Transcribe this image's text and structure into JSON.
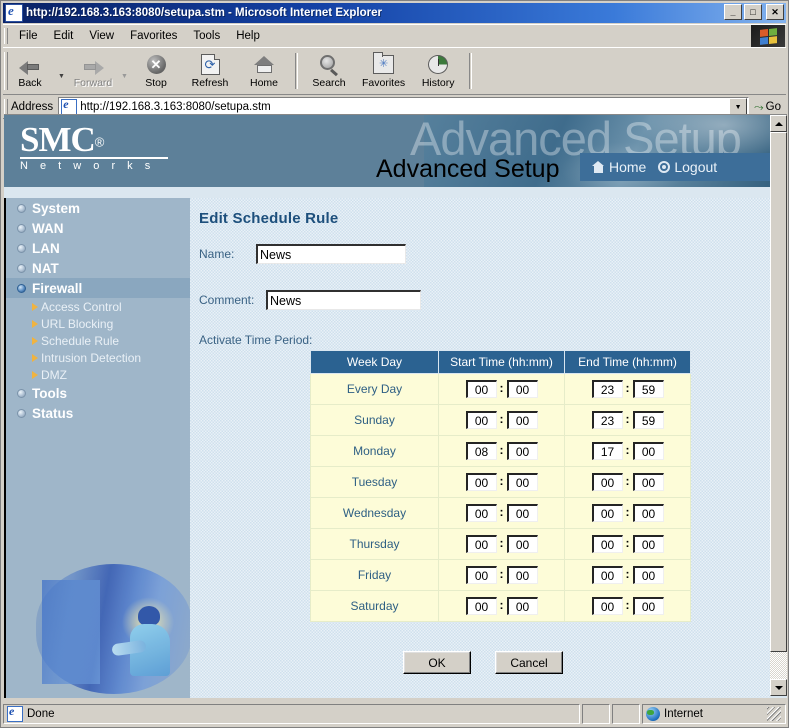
{
  "window": {
    "title": "http://192.168.3.163:8080/setupa.stm - Microsoft Internet Explorer",
    "minimize_label": "_",
    "maximize_label": "□",
    "close_label": "✕"
  },
  "menu": {
    "items": [
      "File",
      "Edit",
      "View",
      "Favorites",
      "Tools",
      "Help"
    ]
  },
  "toolbar": {
    "buttons": [
      {
        "label": "Back",
        "icon": "back-arrow-icon",
        "disabled": false,
        "has_dropdown": true
      },
      {
        "label": "Forward",
        "icon": "forward-arrow-icon",
        "disabled": true,
        "has_dropdown": true
      },
      {
        "label": "Stop",
        "icon": "stop-icon",
        "disabled": false,
        "has_dropdown": false
      },
      {
        "label": "Refresh",
        "icon": "refresh-icon",
        "disabled": false,
        "has_dropdown": false
      },
      {
        "label": "Home",
        "icon": "home-icon",
        "disabled": false,
        "has_dropdown": false
      },
      {
        "label": "Search",
        "icon": "search-icon",
        "disabled": false,
        "has_dropdown": false
      },
      {
        "label": "Favorites",
        "icon": "favorites-folder-icon",
        "disabled": false,
        "has_dropdown": false
      },
      {
        "label": "History",
        "icon": "history-icon",
        "disabled": false,
        "has_dropdown": false
      }
    ]
  },
  "address_bar": {
    "label": "Address",
    "url": "http://192.168.3.163:8080/setupa.stm",
    "go_label": "Go"
  },
  "banner": {
    "logo_text": "SMC",
    "logo_registered": "®",
    "logo_subtitle": "N e t w o r k s",
    "ghost_title": "Advanced Setup",
    "page_title": "Advanced Setup",
    "nav": [
      {
        "label": "Home",
        "icon": "home-icon"
      },
      {
        "label": "Logout",
        "icon": "logout-icon"
      }
    ]
  },
  "sidebar": {
    "items": [
      {
        "label": "System",
        "active": false
      },
      {
        "label": "WAN",
        "active": false
      },
      {
        "label": "LAN",
        "active": false
      },
      {
        "label": "NAT",
        "active": false
      },
      {
        "label": "Firewall",
        "active": true
      },
      {
        "label": "Tools",
        "active": false
      },
      {
        "label": "Status",
        "active": false
      }
    ],
    "sub_items": [
      "Access Control",
      "URL Blocking",
      "Schedule Rule",
      "Intrusion Detection",
      "DMZ"
    ]
  },
  "main": {
    "heading": "Edit Schedule Rule",
    "name_label": "Name:",
    "name_value": "News",
    "comment_label": "Comment:",
    "comment_value": "News",
    "section_label": "Activate Time Period:",
    "table": {
      "headers": [
        "Week Day",
        "Start Time (hh:mm)",
        "End Time (hh:mm)"
      ],
      "rows": [
        {
          "day": "Every Day",
          "start_hh": "00",
          "start_mm": "00",
          "end_hh": "23",
          "end_mm": "59"
        },
        {
          "day": "Sunday",
          "start_hh": "00",
          "start_mm": "00",
          "end_hh": "23",
          "end_mm": "59"
        },
        {
          "day": "Monday",
          "start_hh": "08",
          "start_mm": "00",
          "end_hh": "17",
          "end_mm": "00"
        },
        {
          "day": "Tuesday",
          "start_hh": "00",
          "start_mm": "00",
          "end_hh": "00",
          "end_mm": "00"
        },
        {
          "day": "Wednesday",
          "start_hh": "00",
          "start_mm": "00",
          "end_hh": "00",
          "end_mm": "00"
        },
        {
          "day": "Thursday",
          "start_hh": "00",
          "start_mm": "00",
          "end_hh": "00",
          "end_mm": "00"
        },
        {
          "day": "Friday",
          "start_hh": "00",
          "start_mm": "00",
          "end_hh": "00",
          "end_mm": "00"
        },
        {
          "day": "Saturday",
          "start_hh": "00",
          "start_mm": "00",
          "end_hh": "00",
          "end_mm": "00"
        }
      ]
    },
    "ok_label": "OK",
    "cancel_label": "Cancel"
  },
  "status_bar": {
    "message": "Done",
    "zone": "Internet"
  },
  "colors": {
    "titlebar_blue": "#0a246a",
    "banner_blue": "#5d8099",
    "sidebar_blue": "#9fb6c9",
    "sidebar_active": "#8aa7bf",
    "content_bg": "#cfe0ed",
    "table_header": "#2b6291",
    "table_row": "#fdfcd8",
    "heading_blue": "#1d4f7c",
    "nav_bar": "#3d6e99",
    "arrow_orange": "#f0b340"
  }
}
